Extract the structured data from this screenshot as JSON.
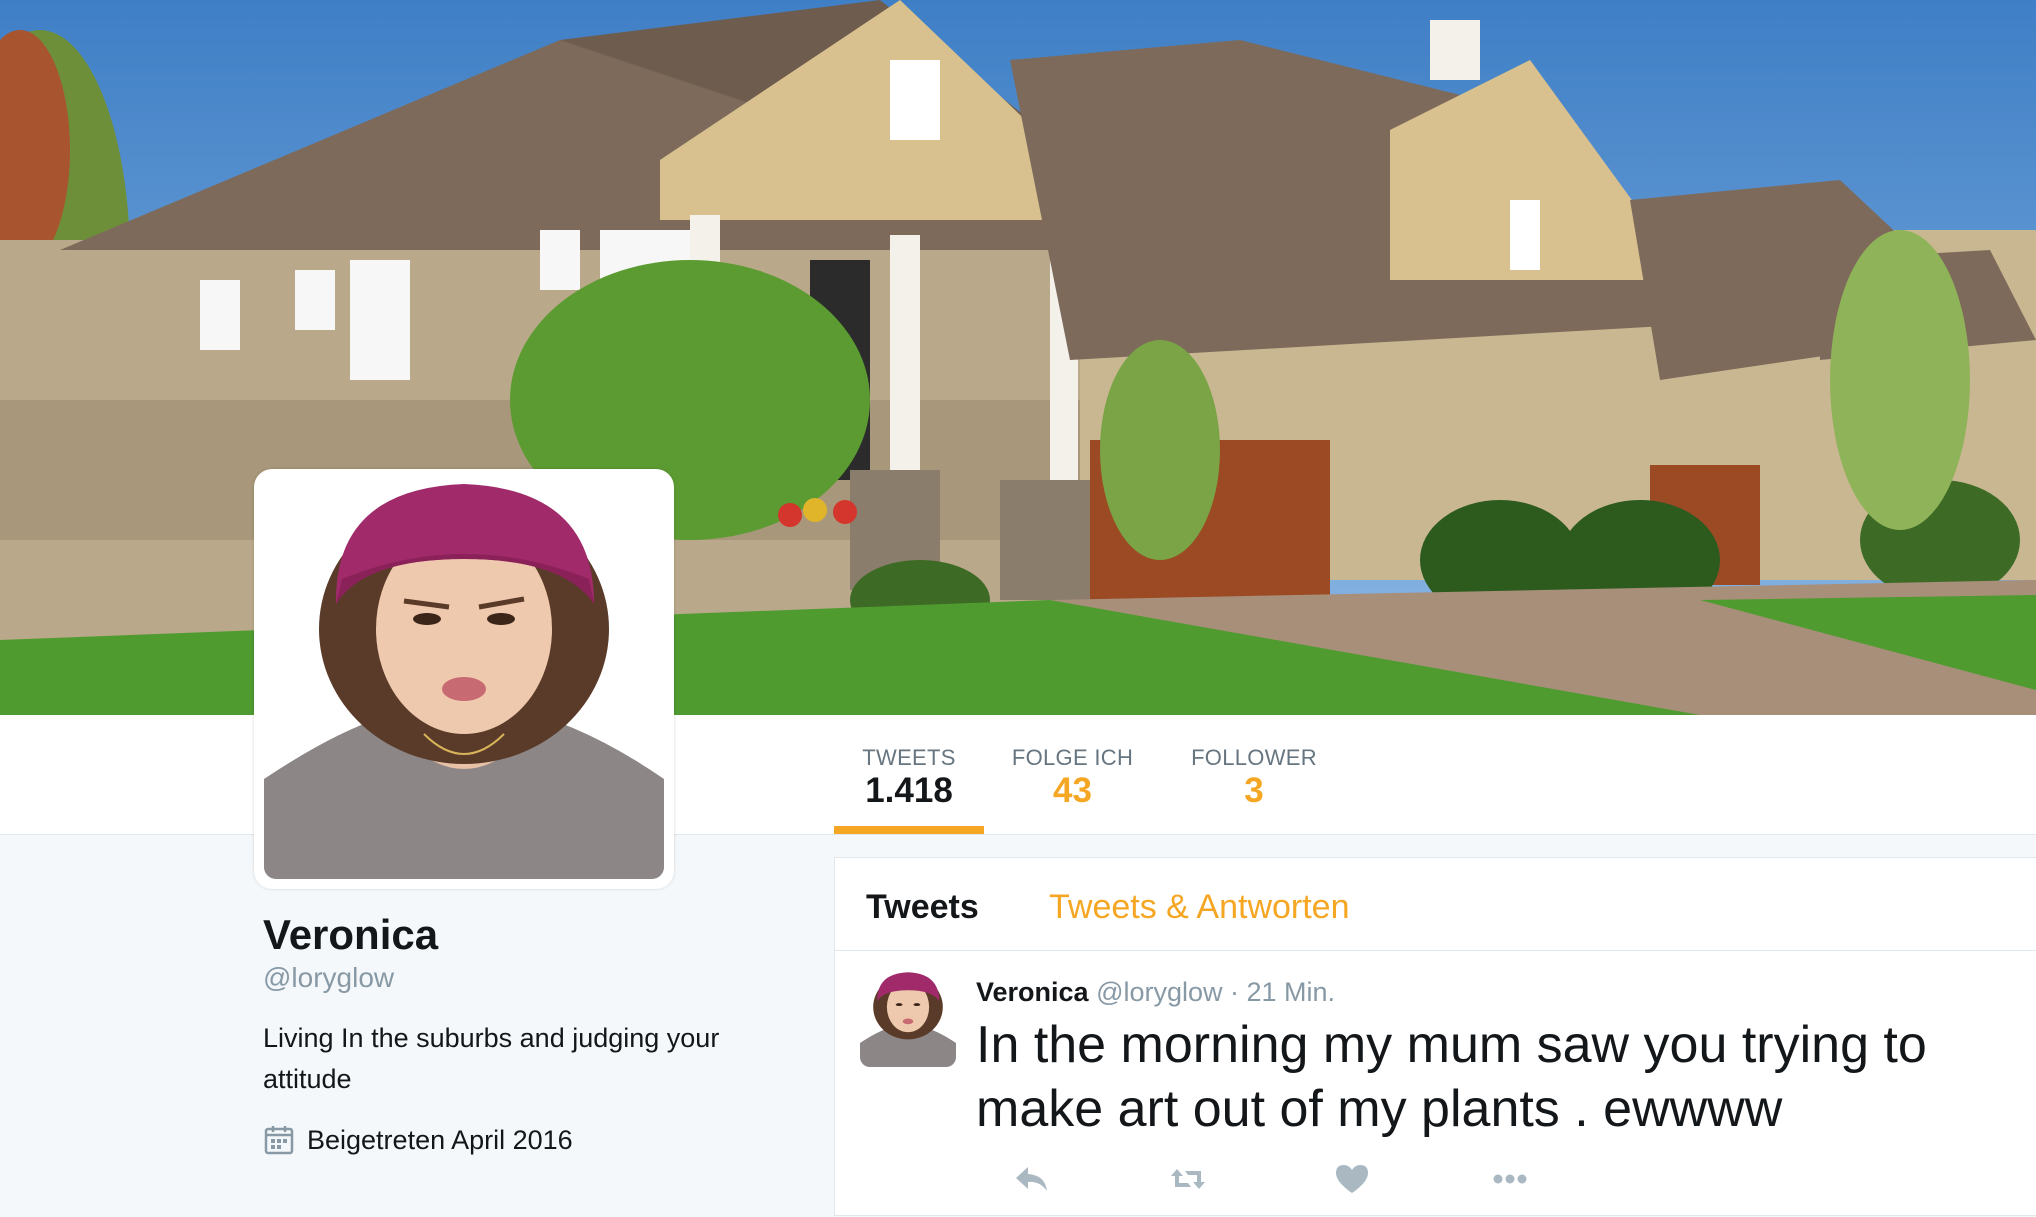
{
  "profile": {
    "name": "Veronica",
    "handle": "@loryglow",
    "bio": "Living In the suburbs and judging your attitude",
    "joined": "Beigetreten April 2016",
    "avatar_icon": "user-avatar-photo",
    "header_image": "suburban-houses-photo"
  },
  "nav": {
    "stats": [
      {
        "label": "TWEETS",
        "value": "1.418"
      },
      {
        "label": "FOLGE ICH",
        "value": "43"
      },
      {
        "label": "FOLLOWER",
        "value": "3"
      }
    ]
  },
  "timeline": {
    "tabs": [
      {
        "label": "Tweets"
      },
      {
        "label": "Tweets & Antworten"
      }
    ],
    "tweets": [
      {
        "author": "Veronica",
        "meta": "@loryglow · 21 Min.",
        "text": "In the morning my mum saw you trying to make art out of my plants . ewwww",
        "actions": [
          "reply-icon",
          "retweet-icon",
          "heart-icon",
          "more-icon"
        ]
      }
    ]
  },
  "colors": {
    "accent": "#f5a623",
    "text": "#14171a",
    "muted": "#8899a6",
    "background": "#f5f8fa"
  }
}
